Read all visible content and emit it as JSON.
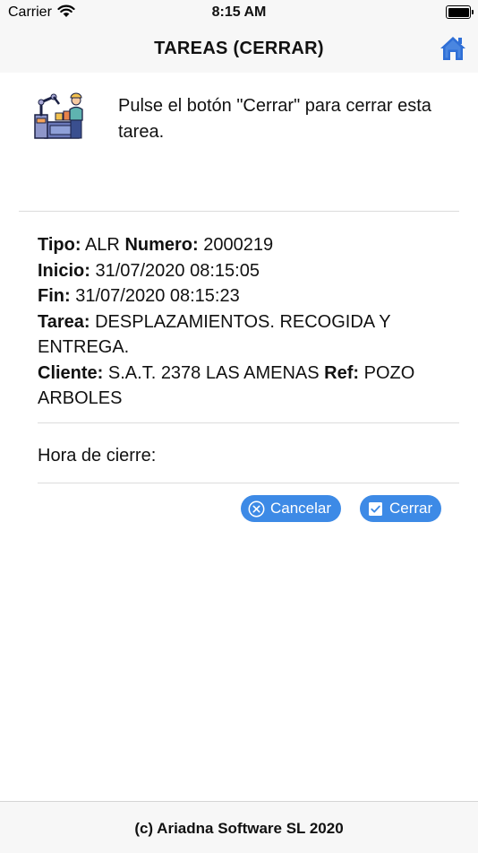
{
  "status_bar": {
    "carrier": "Carrier",
    "time": "8:15 AM"
  },
  "nav": {
    "title": "TAREAS (CERRAR)",
    "home_icon": "home-icon"
  },
  "info": {
    "message": "Pulse el botón \"Cerrar\" para cerrar esta tarea.",
    "icon": "factory-worker-icon"
  },
  "task": {
    "tipo_label": "Tipo:",
    "tipo_value": "ALR",
    "numero_label": "Numero:",
    "numero_value": "2000219",
    "inicio_label": "Inicio:",
    "inicio_value": "31/07/2020 08:15:05",
    "fin_label": "Fin:",
    "fin_value": "31/07/2020 08:15:23",
    "tarea_label": "Tarea:",
    "tarea_value": "DESPLAZAMIENTOS. RECOGIDA Y ENTREGA.",
    "cliente_label": "Cliente:",
    "cliente_value": "S.A.T. 2378 LAS AMENAS",
    "ref_label": "Ref:",
    "ref_value": "POZO ARBOLES"
  },
  "form": {
    "close_time_label": "Hora de cierre:",
    "close_time_value": ""
  },
  "buttons": {
    "cancel_label": "Cancelar",
    "cancel_icon": "x-circle-icon",
    "close_label": "Cerrar",
    "close_icon": "checkbox-icon"
  },
  "footer": {
    "text": "(c) Ariadna Software SL 2020"
  },
  "colors": {
    "accent": "#3d8ae6",
    "bar_background": "#f7f7f7",
    "home_icon": "#2f6fd6"
  }
}
